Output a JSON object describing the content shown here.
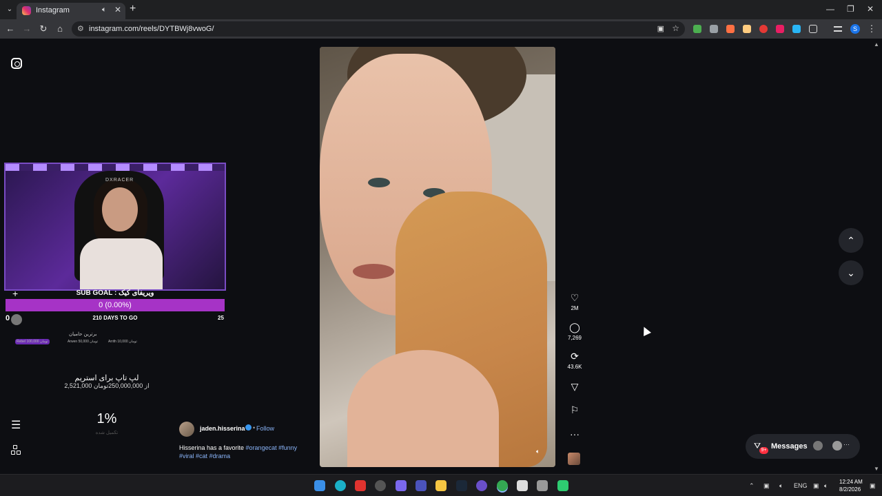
{
  "browser": {
    "tab_title": "Instagram",
    "url": "instagram.com/reels/DYTBWj8vwoG/",
    "profile_initial": "S"
  },
  "icons": {
    "tab_menu": "chevron-down-icon",
    "mute": "speaker-icon",
    "close": "close-icon",
    "new_tab": "plus-icon",
    "back": "arrow-left-icon",
    "forward": "arrow-right-icon",
    "reload": "reload-icon",
    "home": "home-icon",
    "site_info": "site-info-icon",
    "cast": "cast-icon",
    "bookmark": "star-icon",
    "like": "heart-icon",
    "comment": "comment-icon",
    "repost": "repost-icon",
    "share": "send-icon",
    "save": "bookmark-icon",
    "more": "ellipsis-icon",
    "messages": "messenger-icon"
  },
  "glyphs": {
    "tab_menu": "⌄",
    "mute": "🔈︎",
    "close": "✕",
    "new_tab": "+",
    "back": "←",
    "forward": "→",
    "reload": "↻",
    "home": "⌂",
    "site_info": "⚙",
    "cast": "▣",
    "star": "☆",
    "kebab": "⋮",
    "minimize": "—",
    "maximize": "❐",
    "win_close": "✕",
    "hamburger": "☰",
    "plus": "+",
    "heart": "♡",
    "comment": "◯",
    "repost": "⟳",
    "send": "▽",
    "bookmark": "⚐",
    "ellipsis": "···",
    "sound": "🔈︎",
    "up": "⌃",
    "down": "⌄",
    "messenger": "⛛",
    "scroll_up": "▲",
    "scroll_down": "▼"
  },
  "stream_overlay": {
    "camera_brand": "DXRACER",
    "subgoal_title": "SUB GOAL : ویریفای کیک",
    "subgoal_value": "0 (0.00%)",
    "subgoal_start": "0",
    "subgoal_days": "210 DAYS TO GO",
    "subgoal_target": "25",
    "donors_title": "برترین حامیان",
    "donors": [
      {
        "name": "Rebel",
        "amount": "100,000 تومان"
      },
      {
        "name": "Arwen",
        "amount": "50,000 تومان"
      },
      {
        "name": "Arrith",
        "amount": "10,000 تومان"
      }
    ],
    "donate_title": "لپ تاپ برای استریم",
    "donate_progress": "2,521,000 از 250,000,000تومان",
    "percent": "1%",
    "percent_label": "تکمیل شده"
  },
  "reel": {
    "likes": "2M",
    "comments": "7,269",
    "reposts": "43.6K",
    "author": "jaden.hisserina",
    "separator": "•",
    "follow_label": "Follow",
    "caption_text": "Hisserina has a favorite ",
    "hashtags": [
      "#orangecat",
      "#funny",
      "#viral",
      "#cat",
      "#drama"
    ]
  },
  "messages": {
    "label": "Messages",
    "badge": "9+"
  },
  "taskbar": {
    "language": "ENG",
    "time": "12:24 AM",
    "date": "8/2/2026"
  },
  "colors": {
    "instagram_link": "#8ab4f8",
    "subgoal_bar": "#a633c6",
    "verified": "#3897f0",
    "badge": "#ff3040"
  }
}
